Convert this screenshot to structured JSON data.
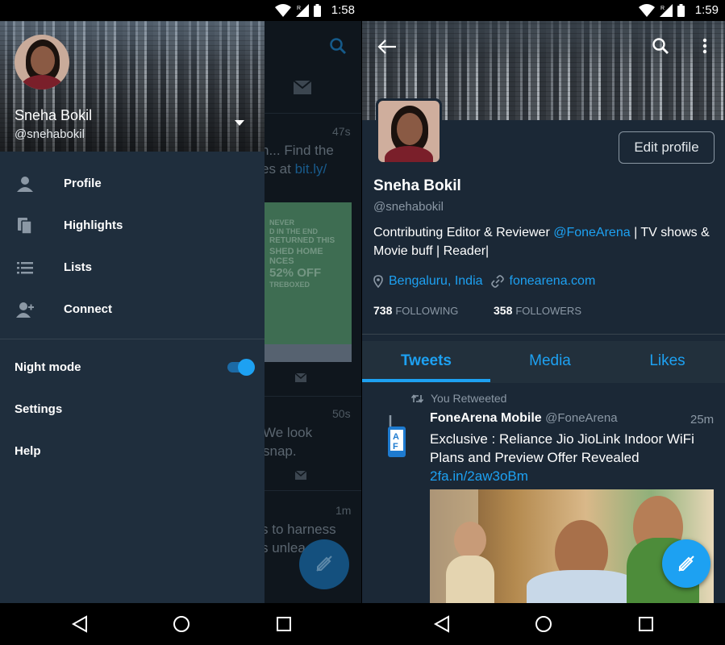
{
  "left": {
    "status": {
      "time": "1:58"
    },
    "drawer": {
      "name": "Sneha Bokil",
      "handle": "@snehabokil",
      "menu": [
        {
          "label": "Profile",
          "icon": "person-icon"
        },
        {
          "label": "Highlights",
          "icon": "highlights-icon"
        },
        {
          "label": "Lists",
          "icon": "lists-icon"
        },
        {
          "label": "Connect",
          "icon": "connect-icon"
        }
      ],
      "night_mode_label": "Night mode",
      "night_mode_on": true,
      "settings_label": "Settings",
      "help_label": "Help"
    },
    "background_feed": {
      "time_1": "47s",
      "text_1a": "n... Find the",
      "text_1b": "es at",
      "link_1": "bit.ly/",
      "promo_lines": [
        "NEVER",
        "D IN THE END",
        "RETURNED THIS",
        "SHED HOME",
        "NCES",
        "52% OFF",
        "TREBOXED"
      ],
      "time_2": "50s",
      "text_2a": "We look",
      "text_2b": "snap.",
      "time_3": "1m",
      "text_3a": "s to harness",
      "text_3b": "s unlea"
    }
  },
  "right": {
    "status": {
      "time": "1:59"
    },
    "profile": {
      "edit_label": "Edit profile",
      "name": "Sneha Bokil",
      "handle": "@snehabokil",
      "bio_pre": "Contributing Editor & Reviewer ",
      "bio_mention": "@FoneArena",
      "bio_post": " | TV shows & Movie buff | Reader|",
      "location": "Bengaluru, India",
      "website": "fonearena.com",
      "following_count": "738",
      "following_label": "FOLLOWING",
      "followers_count": "358",
      "followers_label": "FOLLOWERS"
    },
    "tabs": [
      "Tweets",
      "Media",
      "Likes"
    ],
    "tweet": {
      "retweet_label": "You Retweeted",
      "author": "FoneArena Mobile",
      "author_handle": "@FoneArena",
      "time": "25m",
      "text": "Exclusive : Reliance Jio JioLink Indoor WiFi Plans and Preview Offer Revealed ",
      "link": "2fa.in/2aw3oBm",
      "avatar_letters": "F A"
    }
  },
  "colors": {
    "accent": "#1da1f2",
    "background": "#1b2836",
    "drawer": "#1f2e3d",
    "secondary_text": "#8b98a5"
  }
}
